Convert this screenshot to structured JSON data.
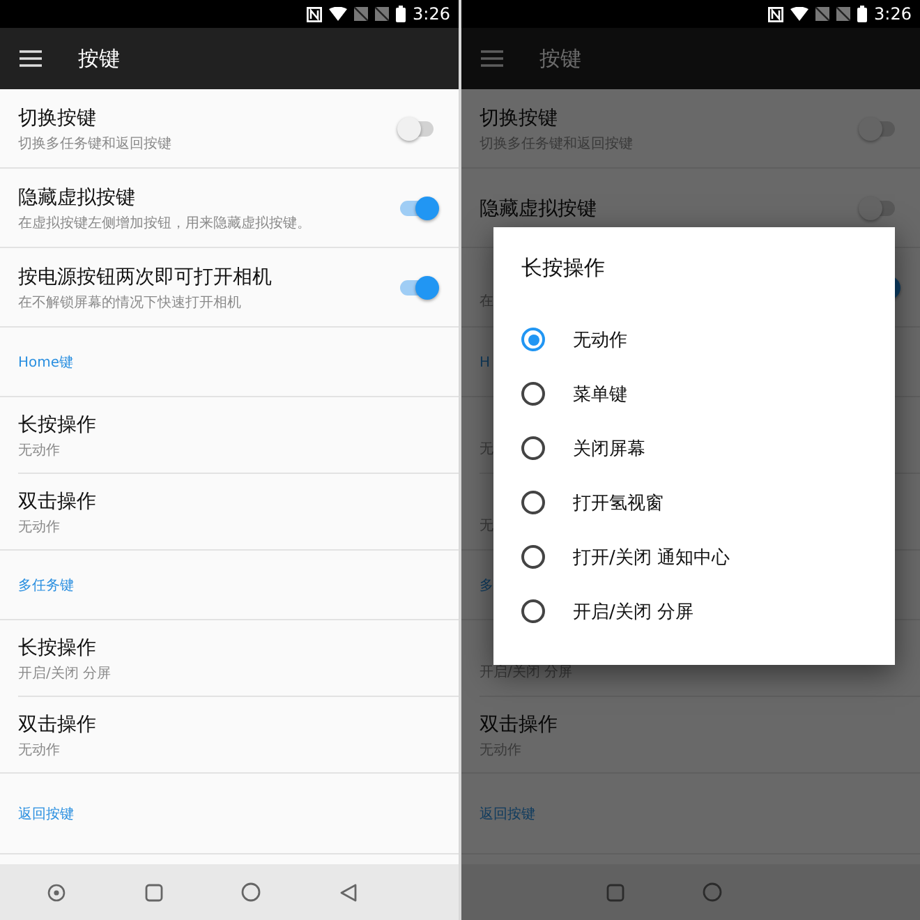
{
  "screens": [
    {
      "status_time": "3:26",
      "title": "按键",
      "dimmed": false,
      "rows": [
        {
          "kind": "toggle",
          "title": "切换按键",
          "subtitle": "切换多任务键和返回按键",
          "on": false
        },
        {
          "kind": "toggle",
          "title": "隐藏虚拟按键",
          "subtitle": "在虚拟按键左侧增加按钮，用来隐藏虚拟按键。",
          "on": true
        },
        {
          "kind": "toggle",
          "title": "按电源按钮两次即可打开相机",
          "subtitle": "在不解锁屏幕的情况下快速打开相机",
          "on": true
        },
        {
          "kind": "header",
          "title": "Home键"
        },
        {
          "kind": "item",
          "title": "长按操作",
          "subtitle": "无动作"
        },
        {
          "kind": "item",
          "title": "双击操作",
          "subtitle": "无动作"
        },
        {
          "kind": "header",
          "title": "多任务键"
        },
        {
          "kind": "item",
          "title": "长按操作",
          "subtitle": "开启/关闭 分屏"
        },
        {
          "kind": "item",
          "title": "双击操作",
          "subtitle": "无动作"
        },
        {
          "kind": "header",
          "title": "返回按键"
        }
      ]
    },
    {
      "status_time": "3:26",
      "title": "按键",
      "dimmed": true,
      "rows": [
        {
          "kind": "toggle",
          "title": "切换按键",
          "subtitle": "切换多任务键和返回按键",
          "on": false
        },
        {
          "kind": "toggle",
          "title": "隐藏虚拟按键",
          "on": false
        },
        {
          "kind": "toggle",
          "subtitle": "在",
          "on": true
        },
        {
          "kind": "header",
          "title": "H"
        },
        {
          "kind": "item",
          "subtitle": "无"
        },
        {
          "kind": "item",
          "subtitle": "无"
        },
        {
          "kind": "header",
          "title": "多"
        },
        {
          "kind": "item",
          "subtitle": "开启/关闭 分屏"
        },
        {
          "kind": "item",
          "title": "双击操作",
          "subtitle": "无动作"
        },
        {
          "kind": "header",
          "title": "返回按键"
        }
      ],
      "dialog": {
        "title": "长按操作",
        "options": [
          {
            "label": "无动作",
            "selected": true
          },
          {
            "label": "菜单键",
            "selected": false
          },
          {
            "label": "关闭屏幕",
            "selected": false
          },
          {
            "label": "打开氢视窗",
            "selected": false
          },
          {
            "label": "打开/关闭 通知中心",
            "selected": false
          },
          {
            "label": "开启/关闭 分屏",
            "selected": false
          }
        ]
      }
    }
  ]
}
